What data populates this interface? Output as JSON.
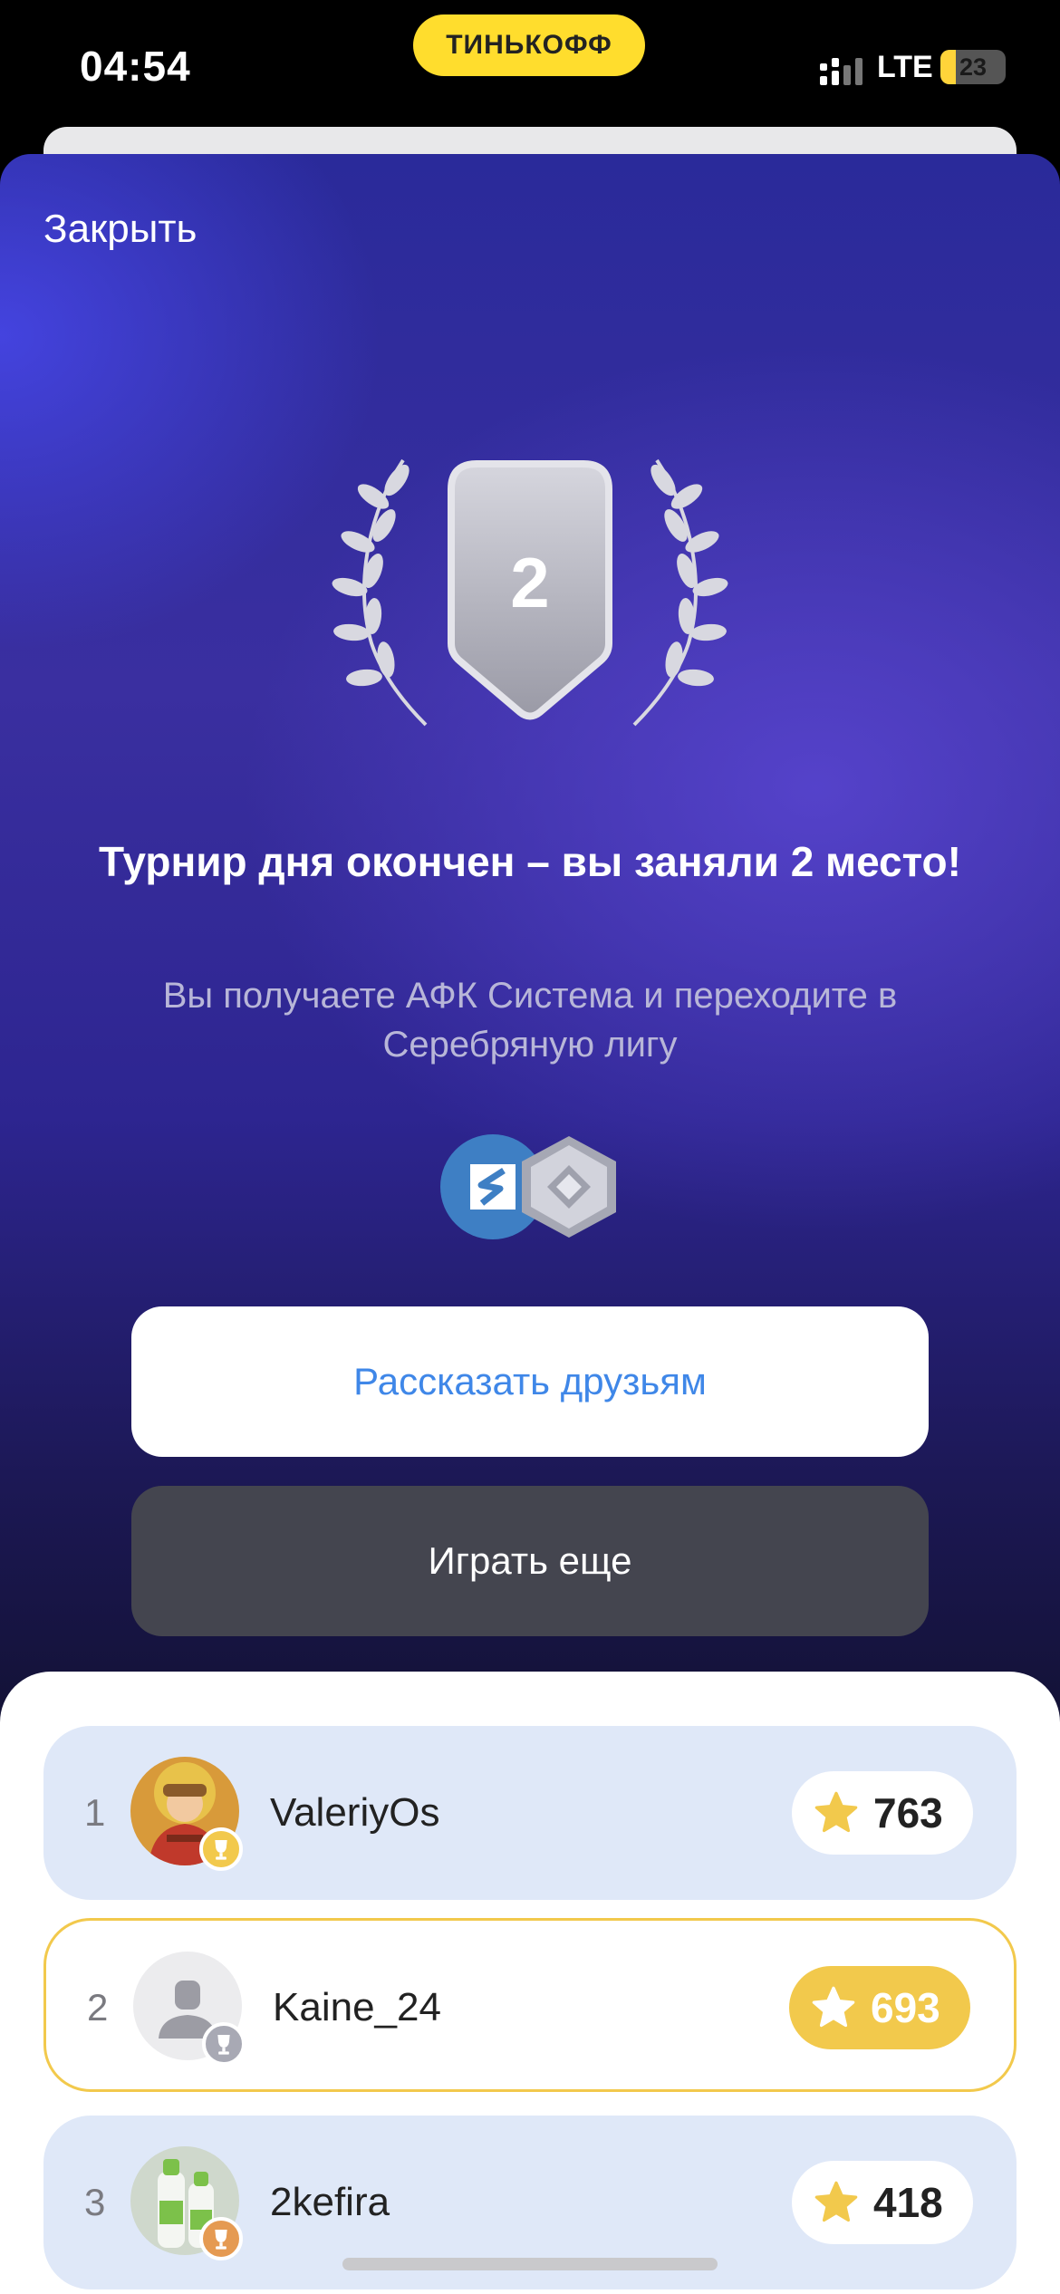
{
  "status_bar": {
    "time": "04:54",
    "brand": "ТИНЬКОФФ",
    "network": "LTE",
    "battery": "23",
    "battery_level": 0.23,
    "brand_color": "#ffdd2d"
  },
  "modal": {
    "close_label": "Закрыть",
    "place_number": "2",
    "headline": "Турнир дня окончен – вы заняли 2 место!",
    "subline": "Вы получаете АФК Система и переходите в Серебряную лигу",
    "prize_icons": [
      "afk-sistema-logo-icon",
      "silver-league-icon"
    ],
    "share_button": "Рассказать друзьям",
    "play_button": "Играть еще"
  },
  "leaderboard": {
    "rows": [
      {
        "rank": "1",
        "name": "ValeriyOs",
        "score": "763",
        "badge": "gold-trophy-icon",
        "highlight": false
      },
      {
        "rank": "2",
        "name": "Kaine_24",
        "score": "693",
        "badge": "silver-trophy-icon",
        "highlight": true
      },
      {
        "rank": "3",
        "name": "2kefira",
        "score": "418",
        "badge": "bronze-trophy-icon",
        "highlight": false
      }
    ]
  },
  "colors": {
    "accent_blue": "#3f87e8",
    "gold": "#f2c94c",
    "row_blue": "#dfe8f8"
  }
}
